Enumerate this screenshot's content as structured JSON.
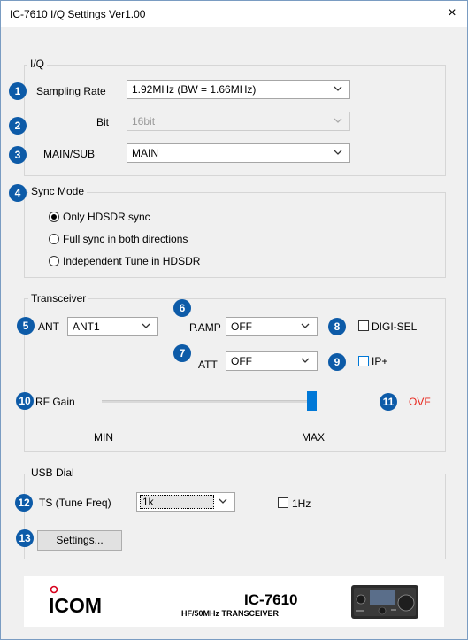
{
  "window": {
    "title": "IC-7610 I/Q Settings   Ver1.00",
    "close_icon": "×"
  },
  "iq": {
    "group_label": "I/Q",
    "sampling_rate": {
      "badge": "1",
      "label": "Sampling Rate",
      "value": "1.92MHz (BW = 1.66MHz)"
    },
    "bit": {
      "badge": "2",
      "label": "Bit",
      "value": "16bit"
    },
    "main_sub": {
      "badge": "3",
      "label": "MAIN/SUB",
      "value": "MAIN"
    }
  },
  "sync": {
    "badge": "4",
    "group_label": "Sync Mode",
    "options": [
      "Only HDSDR sync",
      "Full sync in both directions",
      "Independent Tune in HDSDR"
    ],
    "selected_index": 0
  },
  "transceiver": {
    "group_label": "Transceiver",
    "ant": {
      "badge": "5",
      "label": "ANT",
      "value": "ANT1"
    },
    "pamp": {
      "badge": "6",
      "label": "P.AMP",
      "value": "OFF"
    },
    "att": {
      "badge": "7",
      "label": "ATT",
      "value": "OFF"
    },
    "digisel": {
      "badge": "8",
      "label": "DIGI-SEL",
      "checked": false
    },
    "ipplus": {
      "badge": "9",
      "label": "IP+",
      "checked": false
    },
    "rfgain": {
      "badge": "10",
      "label": "RF Gain",
      "min_label": "MIN",
      "max_label": "MAX",
      "level": 1.0
    },
    "ovf": {
      "badge": "11",
      "label": "OVF",
      "color": "#e8261c"
    }
  },
  "usb_dial": {
    "group_label": "USB Dial",
    "ts": {
      "badge": "12",
      "label": "TS (Tune Freq)",
      "value": "1k"
    },
    "onehz": {
      "label": "1Hz",
      "checked": false
    },
    "settings": {
      "badge": "13",
      "label": "Settings..."
    }
  },
  "banner": {
    "brand": "ICOM",
    "model": "IC-7610",
    "subtitle": "HF/50MHz TRANSCEIVER"
  },
  "colors": {
    "badge": "#0d5ba8",
    "accent": "#0078d7",
    "ovf": "#e8261c"
  }
}
